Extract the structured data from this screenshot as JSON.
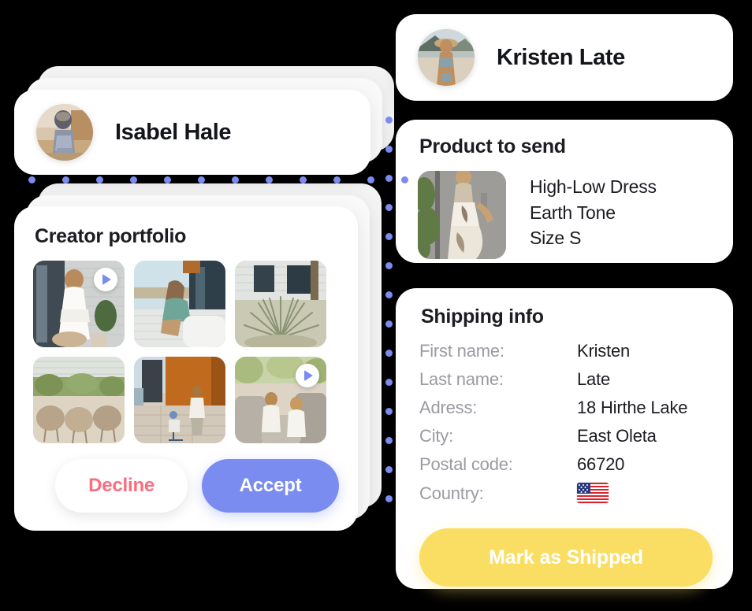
{
  "left_panel": {
    "creator": {
      "name": "Isabel Hale",
      "avatar_icon": "avatar-isabel-image"
    },
    "portfolio": {
      "title": "Creator portfolio",
      "items": [
        {
          "caption": "woman-white-dress-porch",
          "has_video": true
        },
        {
          "caption": "woman-green-dress-deck",
          "has_video": false
        },
        {
          "caption": "ornamental-grass-house",
          "has_video": false
        },
        {
          "caption": "patio-wicker-chairs",
          "has_video": false
        },
        {
          "caption": "family-walking-orange-wall",
          "has_video": false
        },
        {
          "caption": "mother-child-outdoor-sofa",
          "has_video": true
        }
      ],
      "play_icon": "play-icon"
    },
    "actions": {
      "decline_label": "Decline",
      "accept_label": "Accept"
    }
  },
  "right_panel": {
    "customer": {
      "name": "Kristen Late",
      "avatar_icon": "avatar-kristen-image"
    },
    "product": {
      "title": "Product to send",
      "thumbnail_icon": "product-dress-image",
      "lines": [
        "High-Low Dress",
        "Earth Tone",
        "Size S"
      ]
    },
    "shipping": {
      "title": "Shipping info",
      "fields": [
        {
          "label": "First name:",
          "value": "Kristen",
          "type": "text"
        },
        {
          "label": "Last name:",
          "value": "Late",
          "type": "text"
        },
        {
          "label": "Adress:",
          "value": "18 Hirthe Lake",
          "type": "text"
        },
        {
          "label": "City:",
          "value": "East Oleta",
          "type": "text"
        },
        {
          "label": "Postal code:",
          "value": "66720",
          "type": "text"
        },
        {
          "label": "Country:",
          "value": "",
          "type": "flag",
          "flag_icon": "flag-us-icon"
        }
      ],
      "shipped_label": "Mark as Shipped"
    }
  },
  "colors": {
    "background": "#000000",
    "card": "#ffffff",
    "accent_blue": "#7b8cf0",
    "decline_red": "#fa6c7e",
    "shipped_yellow": "#fade63",
    "label_gray": "#9a9aa2",
    "text_dark": "#1c1d22"
  }
}
